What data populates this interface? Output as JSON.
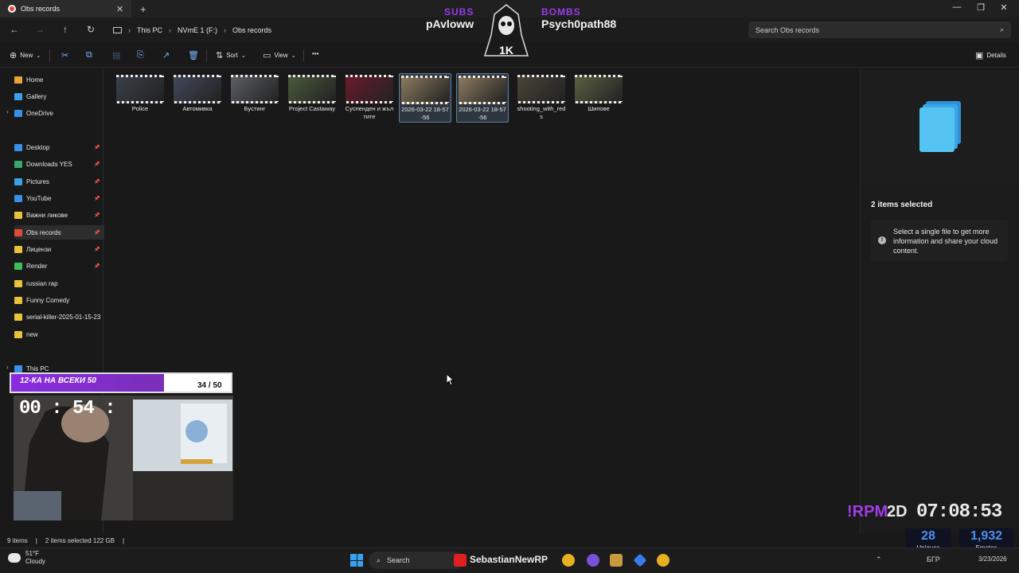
{
  "window": {
    "tab_title": "Obs records",
    "close_glyph": "✕",
    "new_tab_glyph": "+",
    "controls": [
      "—",
      "❐",
      "✕"
    ]
  },
  "address": {
    "crumbs": [
      "This PC",
      "NVmE 1 (F:)",
      "Obs records"
    ],
    "search_placeholder": "Search Obs records"
  },
  "commands": {
    "new": "New",
    "sort": "Sort",
    "view": "View",
    "more": "•••",
    "details": "Details"
  },
  "sidebar": {
    "items": [
      {
        "label": "Home",
        "icon": "home-icon",
        "color": "#e8a33a"
      },
      {
        "label": "Gallery",
        "icon": "gallery-icon",
        "color": "#3aa0e8"
      },
      {
        "label": "OneDrive",
        "icon": "onedrive-icon",
        "color": "#3a8fe8"
      },
      {
        "label": "Desktop",
        "icon": "desktop-icon",
        "color": "#3a8fe8"
      },
      {
        "label": "Downloads YES",
        "icon": "downloads-icon",
        "color": "#3aa86a"
      },
      {
        "label": "Pictures",
        "icon": "pictures-icon",
        "color": "#3aa0e8"
      },
      {
        "label": "YouTube",
        "icon": "folder-icon",
        "color": "#3a8fe8"
      },
      {
        "label": "Важни ликове",
        "icon": "folder-icon",
        "color": "#e8c23a"
      },
      {
        "label": "Obs records",
        "icon": "obs-icon",
        "color": "#e14a3a"
      },
      {
        "label": "Лицензи",
        "icon": "folder-icon",
        "color": "#e8c23a"
      },
      {
        "label": "Render",
        "icon": "check-icon",
        "color": "#3ac05a"
      },
      {
        "label": "russian rap",
        "icon": "folder-icon",
        "color": "#e8c23a"
      },
      {
        "label": "Funny Comedy",
        "icon": "folder-icon",
        "color": "#e8c23a"
      },
      {
        "label": "serial-killer-2025-01-15-23",
        "icon": "folder-icon",
        "color": "#e8c23a"
      },
      {
        "label": "new",
        "icon": "folder-icon",
        "color": "#e8c23a"
      },
      {
        "label": "This PC",
        "icon": "pc-icon",
        "color": "#3a8fe8"
      }
    ]
  },
  "files": [
    {
      "name": "Police",
      "selected": false,
      "tint": "#3a3f4a"
    },
    {
      "name": "Автомивка",
      "selected": false,
      "tint": "#404858"
    },
    {
      "name": "Бустинг",
      "selected": false,
      "tint": "#5a5e64"
    },
    {
      "name": "Project Castaway",
      "selected": false,
      "tint": "#4a5a3c"
    },
    {
      "name": "Суспенден и жълтите",
      "selected": false,
      "tint": "#6a1a2a"
    },
    {
      "name": "2026-03-22 18-57-56",
      "selected": true,
      "tint": "#8a7a5e"
    },
    {
      "name": "2026-03-22 18-57-56",
      "selected": true,
      "tint": "#8a7a5e"
    },
    {
      "name": "shooting_with_reds",
      "selected": false,
      "tint": "#4a4438"
    },
    {
      "name": "Шипове",
      "selected": false,
      "tint": "#5a6040"
    }
  ],
  "details": {
    "title": "2 items selected",
    "info": "Select a single file to get more information and share your cloud content.",
    "info_glyph": "i"
  },
  "status": {
    "items": "9 items",
    "selected": "2 items selected  122 GB",
    "sep": "|"
  },
  "overlay": {
    "subs_label": "SUBS",
    "bombs_label": "BOMBS",
    "subs_name": "pAvloww",
    "bombs_name": "Psych0path88",
    "logo_text": "1K",
    "goal_label": "12-КА НА ВСЕКИ 50",
    "goal_count": "34 / 50",
    "goal_progress": 0.68,
    "cam_timer": "00 : 54 :",
    "rpm_label": "!RPM",
    "rpm_2d": "2D",
    "rpm_clock": "07:08:53",
    "uniques_num": "28",
    "uniques_label": "Uniques",
    "emotes_num": "1,932",
    "emotes_label": "Emotes"
  },
  "taskbar": {
    "weather_temp": "51°F",
    "weather_desc": "Cloudy",
    "search": "Search",
    "overlay_name": "SebastianNewRP",
    "lang": "БГР",
    "date": "3/23/2026"
  }
}
